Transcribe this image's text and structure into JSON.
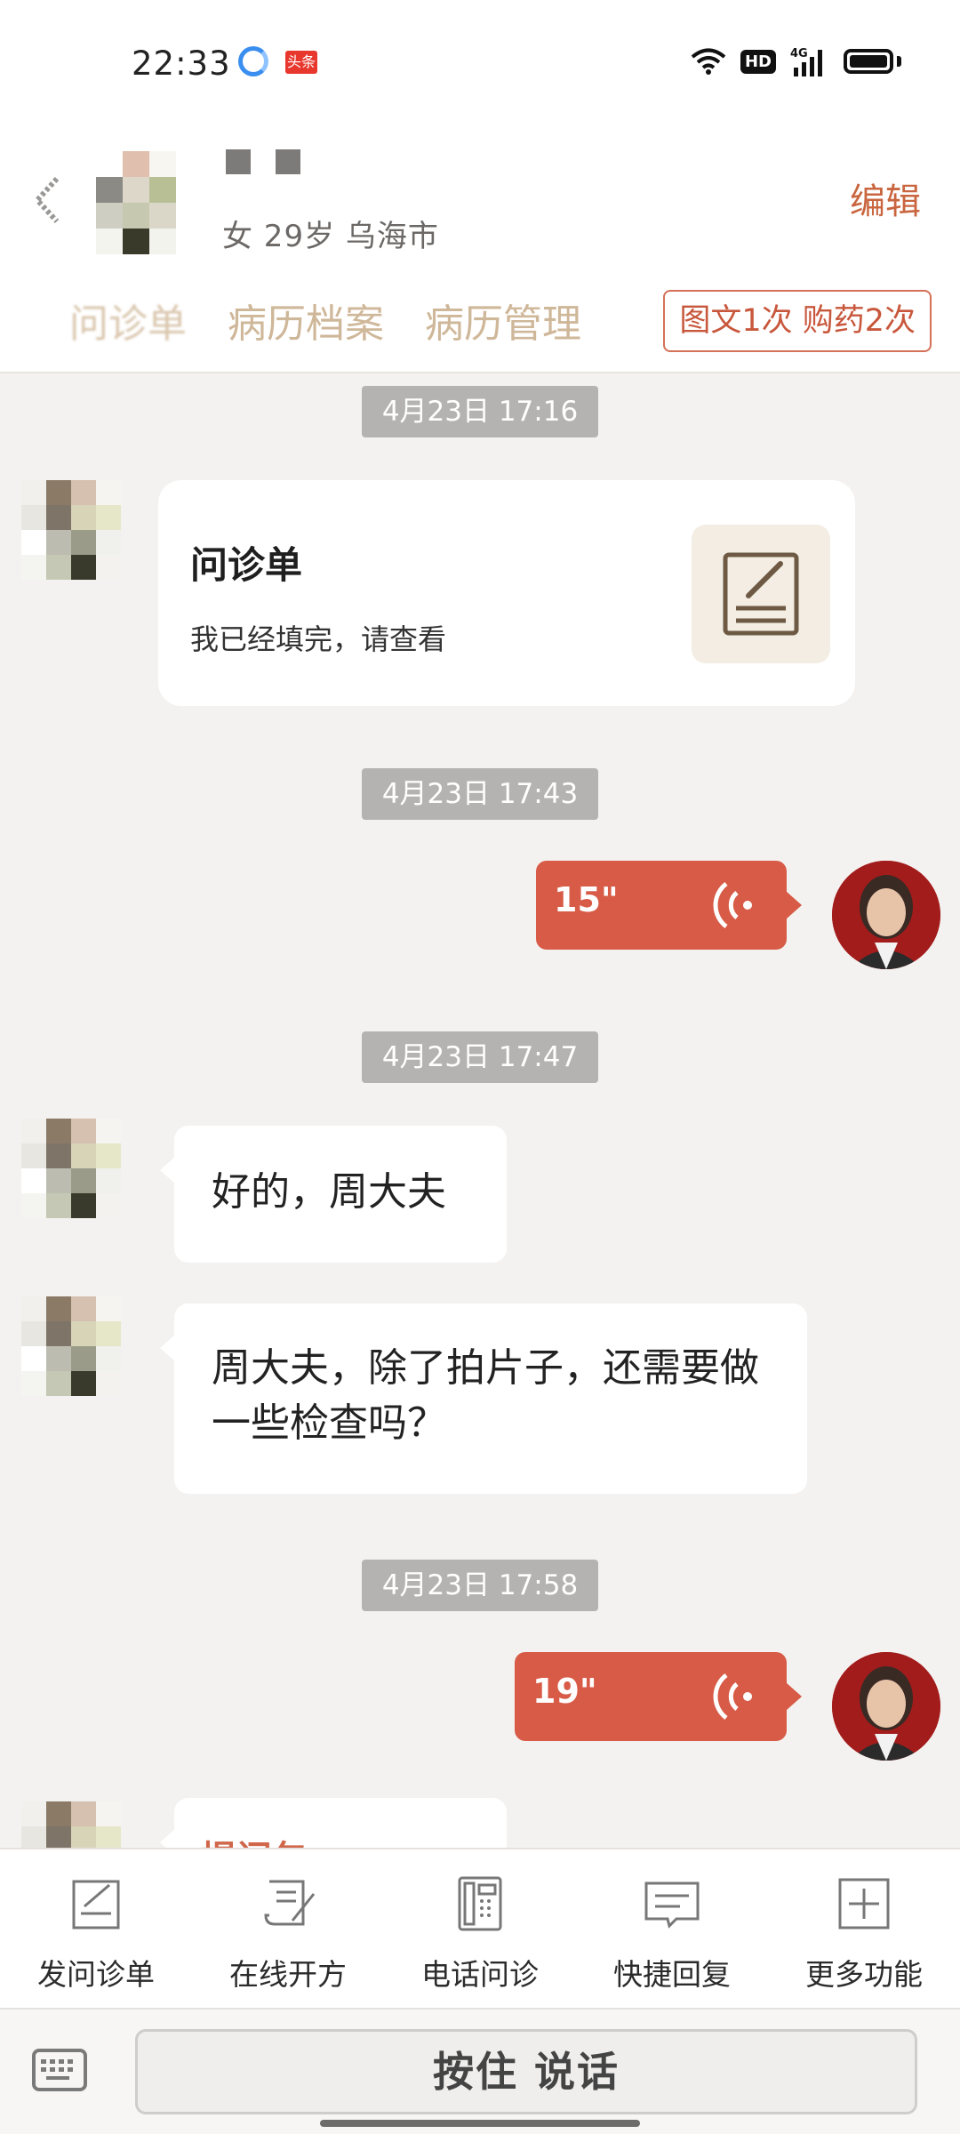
{
  "status_bar": {
    "time": "22:33",
    "app_badge": "头条",
    "network": "4G",
    "hd": "HD",
    "icons": [
      "browser-app-icon",
      "toutiao-app-icon",
      "wifi-icon",
      "hd-icon",
      "signal-icon",
      "battery-icon"
    ]
  },
  "header": {
    "patient_info": "女 29岁  乌海市",
    "edit_label": "编辑",
    "tabs": [
      "问诊单",
      "病历档案",
      "病历管理"
    ],
    "consult_badge": "图文1次 购药2次"
  },
  "chat": {
    "messages": [
      {
        "type": "timestamp",
        "text": "4月23日 17:16"
      },
      {
        "type": "form_card",
        "side": "left",
        "title": "问诊单",
        "subtitle": "我已经填完，请查看"
      },
      {
        "type": "timestamp",
        "text": "4月23日 17:43"
      },
      {
        "type": "voice",
        "side": "right",
        "duration": "15\""
      },
      {
        "type": "timestamp",
        "text": "4月23日 17:47"
      },
      {
        "type": "text",
        "side": "left",
        "text": "好的，周大夫"
      },
      {
        "type": "text",
        "side": "left",
        "text": "周大夫，除了拍片子，还需要做一些检查吗？"
      },
      {
        "type": "timestamp",
        "text": "4月23日 17:58"
      },
      {
        "type": "voice",
        "side": "right",
        "duration": "19\""
      },
      {
        "type": "card_partial",
        "side": "left",
        "text": "提问包"
      }
    ]
  },
  "toolbar": {
    "items": [
      {
        "label": "发问诊单",
        "icon": "send-form-icon"
      },
      {
        "label": "在线开方",
        "icon": "prescription-icon"
      },
      {
        "label": "电话问诊",
        "icon": "phone-icon"
      },
      {
        "label": "快捷回复",
        "icon": "quick-reply-icon"
      },
      {
        "label": "更多功能",
        "icon": "plus-icon"
      }
    ]
  },
  "input_bar": {
    "hold_to_talk": "按住 说话",
    "keyboard_icon": "keyboard-icon"
  },
  "colors": {
    "accent": "#d75b46",
    "edit": "#c9663f",
    "tab": "#cfb799",
    "chat_bg": "#f4f2f0",
    "timestamp_bg": "#b5b3b1"
  }
}
